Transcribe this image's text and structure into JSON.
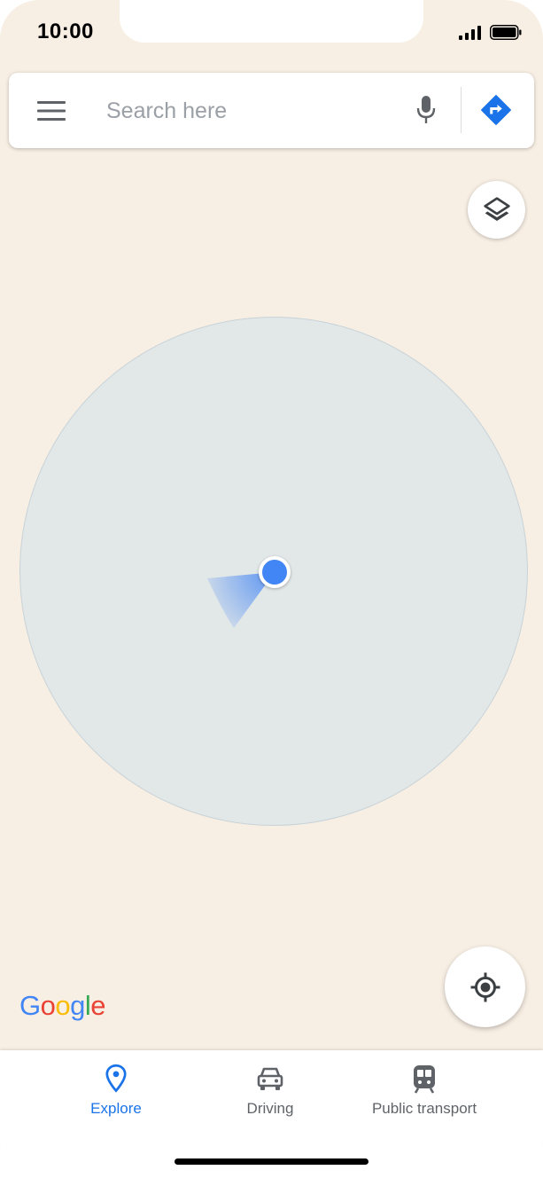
{
  "status_bar": {
    "time": "10:00"
  },
  "search": {
    "placeholder": "Search here",
    "value": ""
  },
  "map": {
    "logo_letters": [
      {
        "char": "G",
        "color": "#4285f4"
      },
      {
        "char": "o",
        "color": "#ea4335"
      },
      {
        "char": "o",
        "color": "#fbbc05"
      },
      {
        "char": "g",
        "color": "#4285f4"
      },
      {
        "char": "l",
        "color": "#34a853"
      },
      {
        "char": "e",
        "color": "#ea4335"
      }
    ],
    "background_color": "#f8efe4",
    "accuracy_color": "#e2e7e8",
    "location_dot_color": "#4285f4"
  },
  "icons": {
    "menu": "menu-icon",
    "mic": "microphone-icon",
    "directions": "directions-icon",
    "layers": "layers-icon",
    "my_location": "my-location-icon"
  },
  "bottom_nav": {
    "items": [
      {
        "label": "Explore",
        "icon": "explore-pin-icon",
        "active": true
      },
      {
        "label": "Driving",
        "icon": "car-icon",
        "active": false
      },
      {
        "label": "Public transport",
        "icon": "train-icon",
        "active": false
      }
    ]
  },
  "colors": {
    "accent": "#1a73e8",
    "inactive": "#5f6368"
  }
}
